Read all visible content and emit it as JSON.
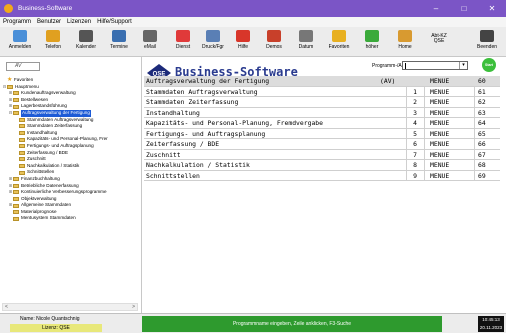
{
  "window": {
    "title": "Business-Software",
    "controls": [
      "–",
      "□",
      "✕"
    ]
  },
  "menu": [
    "Programm",
    "Benutzer",
    "Lizenzen",
    "Hilfe/Support"
  ],
  "toolbar": [
    {
      "label": "Anmelden",
      "icon": "login-icon",
      "color": "#4a8fd8"
    },
    {
      "label": "Telefon",
      "icon": "phone-icon",
      "color": "#e0a020"
    },
    {
      "label": "Kalender",
      "icon": "calendar-icon",
      "color": "#555555"
    },
    {
      "label": "Termine",
      "icon": "appointments-icon",
      "color": "#3a6fb0"
    },
    {
      "label": "eMail",
      "icon": "mail-icon",
      "color": "#666666"
    },
    {
      "label": "Dienst",
      "icon": "service-icon",
      "color": "#e03a3a"
    },
    {
      "label": "Druck/Fgr",
      "icon": "print-icon",
      "color": "#5a7fb5"
    },
    {
      "label": "Hilfe",
      "icon": "help-icon",
      "color": "#d8362a"
    },
    {
      "label": "Demos",
      "icon": "demos-icon",
      "color": "#c8402a"
    },
    {
      "label": "Datum",
      "icon": "date-icon",
      "color": "#777777"
    },
    {
      "label": "Favoriten",
      "icon": "favorites-icon",
      "color": "#e8b020"
    },
    {
      "label": "höher",
      "icon": "up-icon",
      "color": "#3aaa3a"
    },
    {
      "label": "Home",
      "icon": "home-icon",
      "color": "#d89a30"
    },
    {
      "label": "Abt-KZ",
      "label2": "QSE",
      "icon": "dept-code",
      "color": "#ececec"
    },
    {
      "label": "Beenden",
      "icon": "exit-icon",
      "color": "#444444"
    }
  ],
  "sidebar": {
    "search_value": "AV",
    "tree": [
      {
        "label": "Favoriten",
        "level": 0,
        "kind": "star"
      },
      {
        "label": "Hauptmenu",
        "level": 0,
        "kind": "folder",
        "exp": "⊟"
      },
      {
        "label": "Kundenauftragsverwaltung",
        "level": 1,
        "kind": "folder",
        "exp": "⊞"
      },
      {
        "label": "Bestellwesen",
        "level": 1,
        "kind": "folder",
        "exp": "⊞"
      },
      {
        "label": "Lagerbestandsführung",
        "level": 1,
        "kind": "folder",
        "exp": "⊞"
      },
      {
        "label": "Auftragsverwaltung der Fertigung",
        "level": 1,
        "kind": "folder",
        "exp": "⊟",
        "selected": true
      },
      {
        "label": "Stammdaten Auftragsverwaltung",
        "level": 2,
        "kind": "folder"
      },
      {
        "label": "Stammdaten Zeiterfassung",
        "level": 2,
        "kind": "folder"
      },
      {
        "label": "Instandhaltung",
        "level": 2,
        "kind": "folder"
      },
      {
        "label": "Kapazitäts- und Personal-Planung, Frer",
        "level": 2,
        "kind": "folder"
      },
      {
        "label": "Fertigungs- und Auftragsplanung",
        "level": 2,
        "kind": "folder"
      },
      {
        "label": "Zeiterfassung / BDE",
        "level": 2,
        "kind": "folder"
      },
      {
        "label": "Zuschnitt",
        "level": 2,
        "kind": "folder"
      },
      {
        "label": "Nachkalkulation / Statistik",
        "level": 2,
        "kind": "folder"
      },
      {
        "label": "Schnittstellen",
        "level": 2,
        "kind": "folder"
      },
      {
        "label": "Finanzbuchhaltung",
        "level": 1,
        "kind": "folder",
        "exp": "⊞"
      },
      {
        "label": "Betriebliche Datenerfassung",
        "level": 1,
        "kind": "folder",
        "exp": "⊞"
      },
      {
        "label": "Kontinuierliche Verbesserungsprogramme",
        "level": 1,
        "kind": "folder",
        "exp": "⊞"
      },
      {
        "label": "Objektverwaltung",
        "level": 1,
        "kind": "folder"
      },
      {
        "label": "Allgemeine Stammdaten",
        "level": 1,
        "kind": "folder",
        "exp": "⊞"
      },
      {
        "label": "Materialprognose",
        "level": 1,
        "kind": "folder"
      },
      {
        "label": "Mentusystem Stammdaten",
        "level": 1,
        "kind": "folder"
      }
    ],
    "scroll_left": "<",
    "scroll_right": ">"
  },
  "main": {
    "title": "Business-Software",
    "program_label": "Programm-/Auswahl",
    "start_label": "Start",
    "header": {
      "name": "Auftragsverwaltung der Fertigung",
      "av": "(AV)",
      "type": "MENUE",
      "code": "60"
    },
    "rows": [
      {
        "num": "1",
        "name": "Stammdaten Auftragsverwaltung",
        "type": "MENUE",
        "code": "61"
      },
      {
        "num": "2",
        "name": "Stammdaten Zeiterfassung",
        "type": "MENUE",
        "code": "62"
      },
      {
        "num": "3",
        "name": "Instandhaltung",
        "type": "MENUE",
        "code": "63"
      },
      {
        "num": "4",
        "name": "Kapazitäts- und Personal-Planung, Fremdvergabe",
        "type": "MENUE",
        "code": "64"
      },
      {
        "num": "5",
        "name": "Fertigungs- und Auftragsplanung",
        "type": "MENUE",
        "code": "65"
      },
      {
        "num": "6",
        "name": "Zeiterfassung / BDE",
        "type": "MENUE",
        "code": "66"
      },
      {
        "num": "7",
        "name": "Zuschnitt",
        "type": "MENUE",
        "code": "67"
      },
      {
        "num": "8",
        "name": "Nachkalkulation / Statistik",
        "type": "MENUE",
        "code": "68"
      },
      {
        "num": "9",
        "name": "Schnittstellen",
        "type": "MENUE",
        "code": "69"
      }
    ]
  },
  "status": {
    "user": "Name: Nicole Quantschnig",
    "license": "Lizenz: QSE",
    "message": "Programmname eingeben, Zeile anklicken, F3-Suche",
    "time": "10:45:13",
    "date": "20.11.2023"
  },
  "colors": {
    "titlebar": "#7b55c6",
    "selection": "#1e5bd6",
    "status_green": "#2e9a2e",
    "license_yellow": "#e8e87a",
    "title_blue": "#2a3b8f"
  }
}
